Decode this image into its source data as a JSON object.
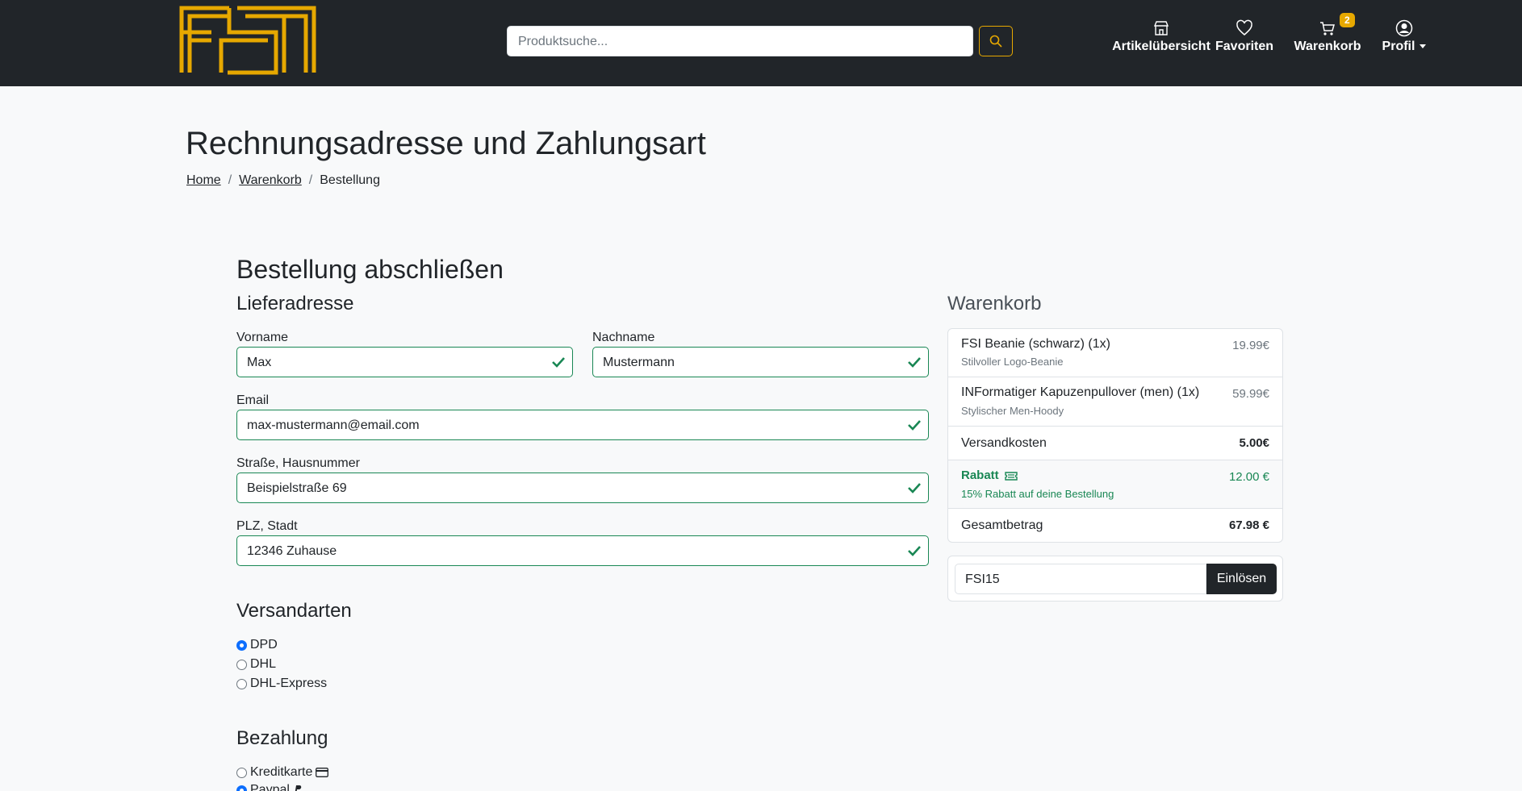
{
  "nav": {
    "search_placeholder": "Produktsuche...",
    "artikel_label": "Artikelübersicht",
    "favoriten_label": "Favoriten",
    "warenkorb_label": "Warenkorb",
    "cart_count": "2",
    "profil_label": "Profil"
  },
  "page": {
    "title": "Rechnungsadresse und Zahlungsart",
    "breadcrumb": [
      "Home",
      "Warenkorb",
      "Bestellung"
    ]
  },
  "form": {
    "heading": "Bestellung abschließen",
    "address_heading": "Lieferadresse",
    "vorname_label": "Vorname",
    "vorname_value": "Max",
    "nachname_label": "Nachname",
    "nachname_value": "Mustermann",
    "email_label": "Email",
    "email_value": "max-mustermann@email.com",
    "strasse_label": "Straße, Hausnummer",
    "strasse_value": "Beispielstraße 69",
    "plz_label": "PLZ, Stadt",
    "plz_value": "12346 Zuhause",
    "shipping_heading": "Versandarten",
    "shipping_options": [
      "DPD",
      "DHL",
      "DHL-Express"
    ],
    "shipping_selected": "DPD",
    "payment_heading": "Bezahlung",
    "payment_options": [
      "Kreditkarte",
      "Paypal"
    ],
    "payment_selected": "Paypal"
  },
  "cart": {
    "heading": "Warenkorb",
    "items": [
      {
        "name": "FSI Beanie (schwarz) (1x)",
        "desc": "Stilvoller Logo-Beanie",
        "price": "19.99€"
      },
      {
        "name": "INFormatiger Kapuzenpullover (men) (1x)",
        "desc": "Stylischer Men-Hoody",
        "price": "59.99€"
      }
    ],
    "shipping_label": "Versandkosten",
    "shipping_price": "5.00€",
    "discount_label": "Rabatt",
    "discount_desc": "15% Rabatt auf deine Bestellung",
    "discount_value": "12.00 €",
    "total_label": "Gesamtbetrag",
    "total_value": "67.98 €",
    "coupon_value": "FSI15",
    "coupon_button": "Einlösen"
  }
}
